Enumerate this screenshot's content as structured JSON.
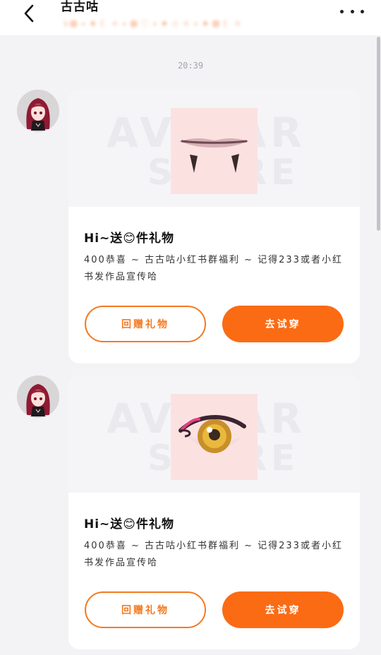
{
  "header": {
    "title": "古古咕",
    "subtitle": "ゝ✿ ⋆ ✦ ☾ ✧ ⋆ ✿ ♡ ⋆ ✦ ☆ ✧ ⋆ ✦ ✿ ☾ ✧",
    "back_icon": "chevron-left-icon",
    "more_icon": "more-horizontal-icon"
  },
  "chat": {
    "timestamp": "20:39",
    "messages": [
      {
        "watermark_line1": "AVATAR",
        "watermark_line2": "STORE",
        "item_icon": "lips-fangs-icon",
        "title": "Hi~送😊件礼物",
        "description": "400恭喜 ~ 古古咕小红书群福利 ~ 记得233或者小红书发作品宣传哈",
        "return_button": "回赠礼物",
        "try_button": "去试穿"
      },
      {
        "watermark_line1": "AVATAR",
        "watermark_line2": "STORE",
        "item_icon": "anime-eye-icon",
        "title": "Hi~送😊件礼物",
        "description": "400恭喜 ~ 古古咕小红书群福利 ~ 记得233或者小红书发作品宣传哈",
        "return_button": "回赠礼物",
        "try_button": "去试穿"
      }
    ]
  },
  "colors": {
    "accent": "#fb6b14",
    "accent_outline": "#f37a22",
    "background": "#f3f3f6",
    "card": "#ffffff"
  }
}
